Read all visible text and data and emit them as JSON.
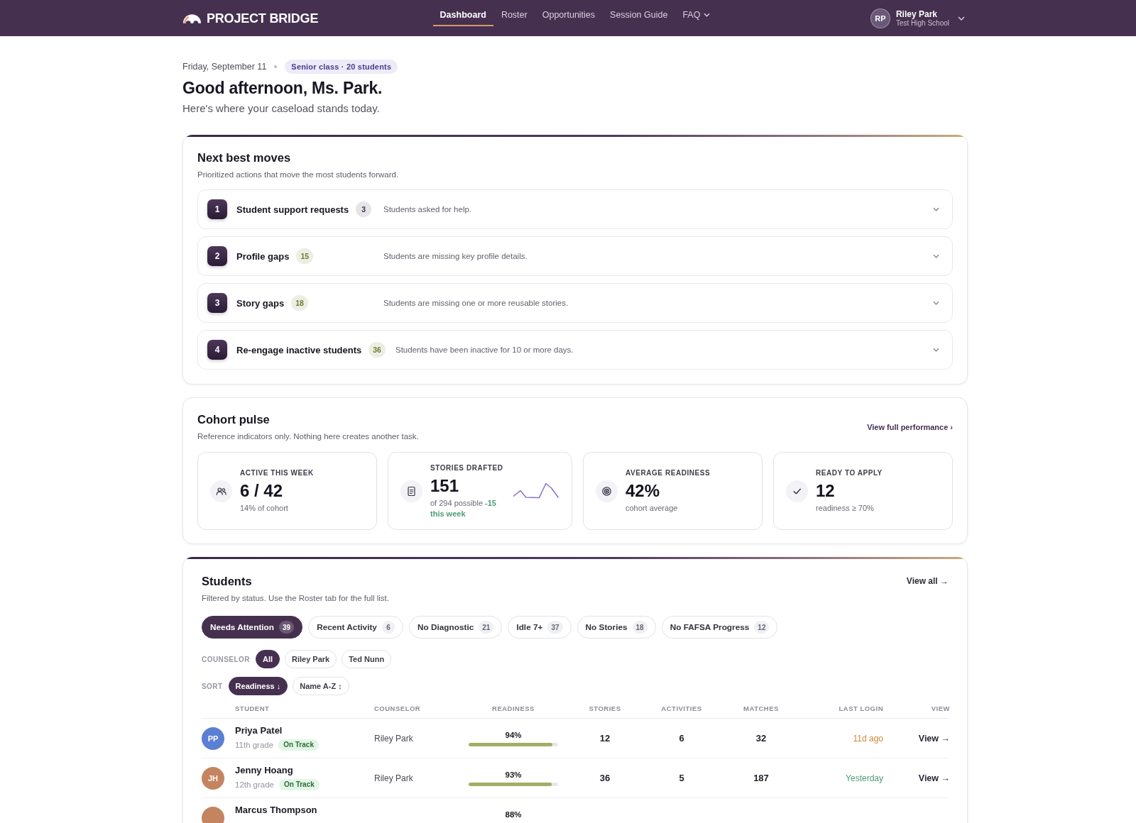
{
  "header": {
    "logo": "PROJECT BRIDGE",
    "nav": [
      {
        "label": "Dashboard",
        "selected": true,
        "has_menu": false
      },
      {
        "label": "Roster",
        "selected": false,
        "has_menu": false
      },
      {
        "label": "Opportunities",
        "selected": false,
        "has_menu": false
      },
      {
        "label": "Session Guide",
        "selected": false,
        "has_menu": false
      },
      {
        "label": "FAQ",
        "selected": false,
        "has_menu": true
      }
    ],
    "user": {
      "initials": "RP",
      "name": "Riley Park",
      "school": "Test High School"
    }
  },
  "greeting": {
    "date": "Friday, September 11",
    "class_badge": "Senior class · 20 students",
    "title": "Good afternoon, Ms. Park.",
    "subtitle": "Here's where your caseload stands today."
  },
  "next_best_moves": {
    "title": "Next best moves",
    "subtitle": "Prioritized actions that move the most students forward.",
    "items": [
      {
        "number": "1",
        "title": "Student support requests",
        "count": "3",
        "color": "#3f3350",
        "description": "Students asked for help.",
        "expanded": false
      },
      {
        "number": "2",
        "title": "Profile gaps",
        "count": "15",
        "color": "#6e7d2f",
        "description": "Students are missing key profile details.",
        "expanded": false
      },
      {
        "number": "3",
        "title": "Story gaps",
        "count": "18",
        "color": "#6e7d2f",
        "description": "Students are missing one or more reusable stories.",
        "expanded": false
      },
      {
        "number": "4",
        "title": "Re-engage inactive students",
        "count": "36",
        "color": "#6e7d2f",
        "description": "Students have been inactive for 10 or more days.",
        "expanded": false
      }
    ]
  },
  "cohort_pulse": {
    "title": "Cohort pulse",
    "subtitle": "Reference indicators only. Nothing here creates another task.",
    "link": "View full performance ›",
    "stats": [
      {
        "kind": "activity",
        "label": "ACTIVE THIS WEEK",
        "value": "6 / 42",
        "note": "14% of cohort"
      },
      {
        "kind": "stories",
        "label": "STORIES DRAFTED",
        "value": "151",
        "note": "of 294 possible **-15 this week**"
      },
      {
        "kind": "readiness",
        "label": "AVERAGE READINESS",
        "value": "42%",
        "note": "cohort average"
      },
      {
        "kind": "ready",
        "label": "READY TO APPLY",
        "value": "12",
        "note": "readiness ≥ 70%"
      }
    ]
  },
  "students": {
    "title": "Students",
    "subtitle": "Filtered by status. Use the Roster tab for the full list.",
    "link": "View all →",
    "filters": [
      {
        "label": "Needs Attention",
        "count": "39",
        "selected": true
      },
      {
        "label": "Recent Activity",
        "count": "6",
        "selected": false
      },
      {
        "label": "No Diagnostic",
        "count": "21",
        "selected": false
      },
      {
        "label": "Idle 7+",
        "count": "37",
        "selected": false
      },
      {
        "label": "No Stories",
        "count": "18",
        "selected": false
      },
      {
        "label": "No FAFSA Progress",
        "count": "12",
        "selected": false
      }
    ],
    "counselor_filter": {
      "label": "COUNSELOR",
      "options": [
        {
          "label": "All",
          "selected": true
        },
        {
          "label": "Riley Park",
          "selected": false
        },
        {
          "label": "Ted Nunn",
          "selected": false
        }
      ]
    },
    "sort": {
      "label": "SORT",
      "options": [
        {
          "label": "Readiness ↓",
          "selected": true
        },
        {
          "label": "Name A-Z ↕",
          "selected": false
        }
      ]
    },
    "table": {
      "columns": [
        "STUDENT",
        "COUNSELOR",
        "READINESS",
        "STORIES",
        "ACTIVITIES",
        "MATCHES",
        "LAST LOGIN",
        "VIEW"
      ],
      "rows": [
        {
          "initials": "PP",
          "color": "#5a7fd3",
          "name": "Priya Patel",
          "grade": "11th grade",
          "status": "On Track",
          "counselor": "Riley Park",
          "readiness": "94%",
          "level": 0.94,
          "stories": "12",
          "activities": "6",
          "matches": "32",
          "last_login": {
            "text": "11d ago",
            "color": "#c98b3b"
          },
          "action": "View →"
        },
        {
          "initials": "JH",
          "color": "#c4845f",
          "name": "Jenny Hoang",
          "grade": "12th grade",
          "status": "On Track",
          "counselor": "Riley Park",
          "readiness": "93%",
          "level": 0.93,
          "stories": "36",
          "activities": "5",
          "matches": "187",
          "last_login": {
            "text": "Yesterday",
            "color": "#4f9a78"
          },
          "action": "View →"
        },
        {
          "color": "#c4845f",
          "name": "Marcus Thompson",
          "readiness": "88%"
        }
      ]
    }
  }
}
